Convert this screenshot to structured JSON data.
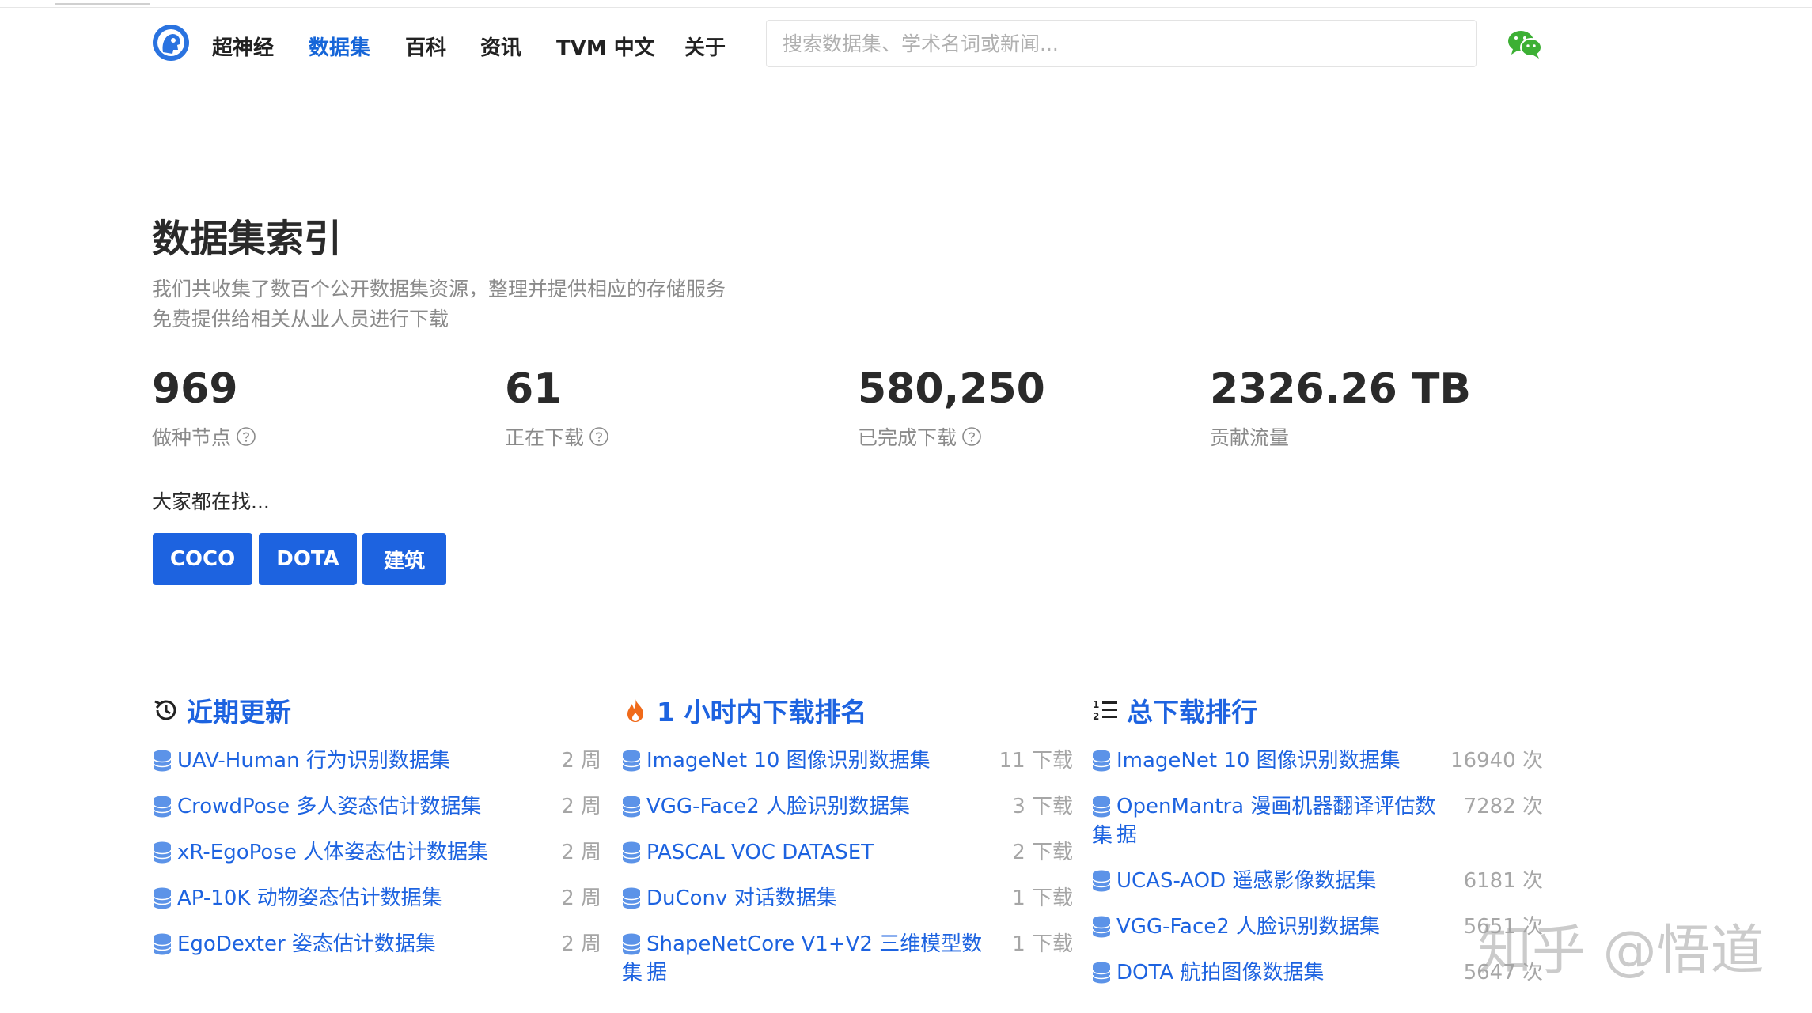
{
  "nav": {
    "items": [
      {
        "label": "超神经",
        "active": false
      },
      {
        "label": "数据集",
        "active": true
      },
      {
        "label": "百科",
        "active": false
      },
      {
        "label": "资讯",
        "active": false
      },
      {
        "label": "TVM 中文",
        "active": false
      },
      {
        "label": "关于",
        "active": false
      }
    ],
    "search_placeholder": "搜索数据集、学术名词或新闻..."
  },
  "hero": {
    "title": "数据集索引",
    "subtitle_lines": [
      "我们共收集了数百个公开数据集资源，整理并提供相应的存储服务",
      "免费提供给相关从业人员进行下载"
    ]
  },
  "stats": [
    {
      "value": "969",
      "label": "做种节点",
      "help": true
    },
    {
      "value": "61",
      "label": "正在下载",
      "help": true
    },
    {
      "value": "580,250",
      "label": "已完成下载",
      "help": true
    },
    {
      "value": "2326.26 TB",
      "label": "贡献流量",
      "help": false
    }
  ],
  "popular": {
    "label": "大家都在找...",
    "tags": [
      "COCO",
      "DOTA",
      "建筑"
    ]
  },
  "sections": [
    {
      "title": "近期更新",
      "icon": "history-icon",
      "items": [
        {
          "name": "UAV-Human 行为识别数据集",
          "meta": "2 周"
        },
        {
          "name": "CrowdPose 多人姿态估计数据集",
          "meta": "2 周"
        },
        {
          "name": "xR-EgoPose 人体姿态估计数据集",
          "meta": "2 周"
        },
        {
          "name": "AP-10K 动物姿态估计数据集",
          "meta": "2 周"
        },
        {
          "name": "EgoDexter 姿态估计数据集",
          "meta": "2 周"
        }
      ]
    },
    {
      "title": "1 小时内下载排名",
      "icon": "fire-icon",
      "items": [
        {
          "name": "ImageNet 10 图像识别数据集",
          "meta": "11 下载"
        },
        {
          "name": "VGG-Face2 人脸识别数据集",
          "meta": "3 下载"
        },
        {
          "name": "PASCAL VOC DATASET",
          "meta": "2 下载"
        },
        {
          "name": "DuConv 对话数据集",
          "meta": "1 下载"
        },
        {
          "name": "ShapeNetCore V1+V2 三维模型数据",
          "name_cont": "集",
          "meta": "1 下载"
        }
      ]
    },
    {
      "title": "总下载排行",
      "icon": "ranking-list-icon",
      "items": [
        {
          "name": "ImageNet 10 图像识别数据集",
          "meta": "16940 次"
        },
        {
          "name": "OpenMantra 漫画机器翻译评估数据",
          "name_cont": "集",
          "meta": "7282 次"
        },
        {
          "name": "UCAS-AOD 遥感影像数据集",
          "meta": "6181 次"
        },
        {
          "name": "VGG-Face2 人脸识别数据集",
          "meta": "5651 次"
        },
        {
          "name": "DOTA 航拍图像数据集",
          "meta": "5647 次"
        }
      ]
    }
  ],
  "watermark": "知乎 @悟道",
  "colors": {
    "accent": "#1d63e0",
    "muted": "#8a8a8a",
    "wechat": "#3cb034",
    "hot": "#f06a1a"
  }
}
